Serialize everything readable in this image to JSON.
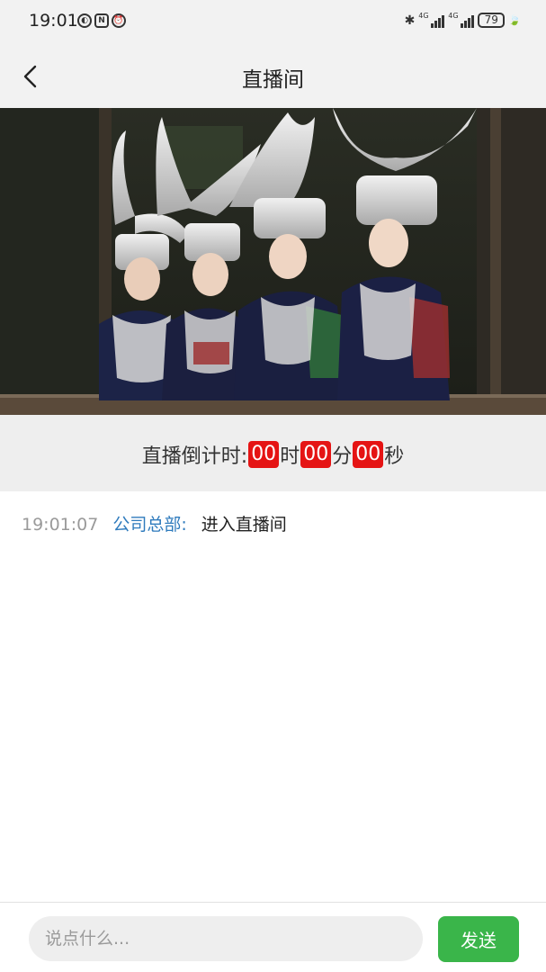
{
  "status_bar": {
    "time": "19:01",
    "network_1": "4G",
    "network_2": "4G",
    "battery": "79"
  },
  "nav": {
    "title": "直播间"
  },
  "countdown": {
    "label": "直播倒计时:",
    "hours": "00",
    "hours_unit": "时",
    "minutes": "00",
    "minutes_unit": "分",
    "seconds": "00",
    "seconds_unit": "秒"
  },
  "messages": [
    {
      "time": "19:01:07",
      "user": "公司总部:",
      "text": "进入直播间"
    }
  ],
  "input": {
    "placeholder": "说点什么...",
    "send_label": "发送"
  },
  "colors": {
    "accent_red": "#e51414",
    "send_green": "#3ab54a",
    "username_blue": "#2f7bbd"
  }
}
